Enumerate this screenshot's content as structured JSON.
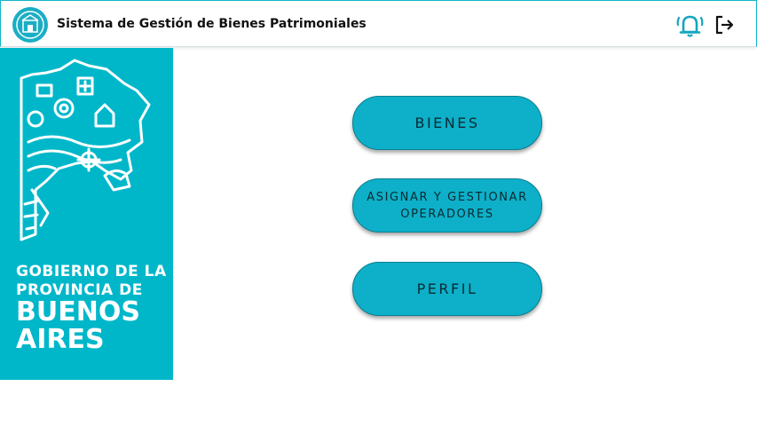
{
  "header": {
    "title": "Sistema de Gestión de Bienes Patrimoniales",
    "icons": [
      "logo-seal-icon",
      "bell-icon",
      "logout-icon"
    ]
  },
  "sidebar": {
    "gov_line1": "GOBIERNO DE LA",
    "gov_line2": "PROVINCIA DE",
    "gov_line3": "BUENOS",
    "gov_line4": "AIRES"
  },
  "menu": {
    "bienes": "BIENES",
    "asignar_line1": "ASIGNAR Y GESTIONAR",
    "asignar_line2": "OPERADORES",
    "perfil": "PERFIL"
  },
  "colors": {
    "accent": "#00b7ca",
    "button": "#0db0c8",
    "bell": "#13a5bf"
  }
}
